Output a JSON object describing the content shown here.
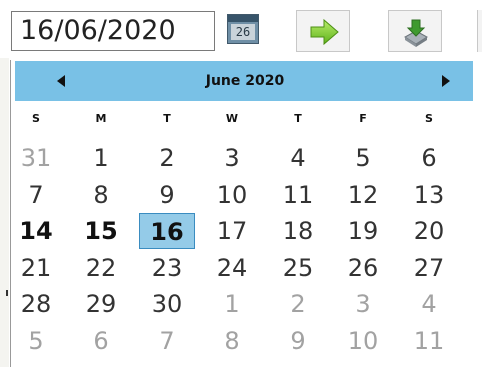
{
  "date_input": {
    "value": "16/06/2020"
  },
  "calendar_button": {
    "icon": "calendar-icon",
    "day_number": "26"
  },
  "toolbar": {
    "go_icon": "green-right-arrow-icon",
    "download_icon": "download-icon"
  },
  "calendar": {
    "month_label": "June 2020",
    "prev_icon": "triangle-left-icon",
    "next_icon": "triangle-right-icon",
    "weekdays": [
      "S",
      "M",
      "T",
      "W",
      "T",
      "F",
      "S"
    ],
    "weeks": [
      [
        {
          "d": "31",
          "s": "muted"
        },
        {
          "d": "1",
          "s": ""
        },
        {
          "d": "2",
          "s": ""
        },
        {
          "d": "3",
          "s": ""
        },
        {
          "d": "4",
          "s": ""
        },
        {
          "d": "5",
          "s": ""
        },
        {
          "d": "6",
          "s": ""
        }
      ],
      [
        {
          "d": "7",
          "s": ""
        },
        {
          "d": "8",
          "s": ""
        },
        {
          "d": "9",
          "s": ""
        },
        {
          "d": "10",
          "s": ""
        },
        {
          "d": "11",
          "s": ""
        },
        {
          "d": "12",
          "s": ""
        },
        {
          "d": "13",
          "s": ""
        }
      ],
      [
        {
          "d": "14",
          "s": "bold"
        },
        {
          "d": "15",
          "s": "bold"
        },
        {
          "d": "16",
          "s": "selected"
        },
        {
          "d": "17",
          "s": ""
        },
        {
          "d": "18",
          "s": ""
        },
        {
          "d": "19",
          "s": ""
        },
        {
          "d": "20",
          "s": ""
        }
      ],
      [
        {
          "d": "21",
          "s": ""
        },
        {
          "d": "22",
          "s": ""
        },
        {
          "d": "23",
          "s": ""
        },
        {
          "d": "24",
          "s": ""
        },
        {
          "d": "25",
          "s": ""
        },
        {
          "d": "26",
          "s": ""
        },
        {
          "d": "27",
          "s": ""
        }
      ],
      [
        {
          "d": "28",
          "s": ""
        },
        {
          "d": "29",
          "s": ""
        },
        {
          "d": "30",
          "s": ""
        },
        {
          "d": "1",
          "s": "muted"
        },
        {
          "d": "2",
          "s": "muted"
        },
        {
          "d": "3",
          "s": "muted"
        },
        {
          "d": "4",
          "s": "muted"
        }
      ],
      [
        {
          "d": "5",
          "s": "muted"
        },
        {
          "d": "6",
          "s": "muted"
        },
        {
          "d": "7",
          "s": "muted"
        },
        {
          "d": "8",
          "s": "muted"
        },
        {
          "d": "9",
          "s": "muted"
        },
        {
          "d": "10",
          "s": "muted"
        },
        {
          "d": "11",
          "s": "muted"
        }
      ]
    ],
    "colors": {
      "header_bg": "#79c1e6",
      "selected_bg": "#94cbe8",
      "muted_text": "#a2a2a2"
    }
  }
}
